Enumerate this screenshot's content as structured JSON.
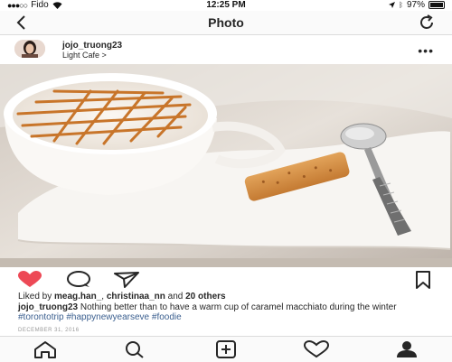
{
  "status_bar": {
    "carrier": "Fido",
    "time": "12:25 PM",
    "battery_percent": "97%",
    "battery_level": 0.97,
    "icons": [
      "signal-dots-icon",
      "wifi-icon",
      "location-arrow-icon",
      "bluetooth-icon",
      "battery-icon"
    ]
  },
  "nav": {
    "title": "Photo",
    "back_icon": "back-chevron-icon",
    "refresh_icon": "refresh-icon"
  },
  "post": {
    "username": "jojo_truong23",
    "location": "Light Cafe >",
    "more_icon": "more-options-icon",
    "photo_description_icon": "caramel-macchiato-photo"
  },
  "actions": {
    "icons": [
      "heart-icon",
      "comment-icon",
      "share-icon",
      "bookmark-icon"
    ],
    "like_color": "#ed4956"
  },
  "likes": {
    "prefix": "Liked by ",
    "user1": "meag.han_",
    "separator": ", ",
    "user2": "christinaa_nn",
    "middle": " and ",
    "others": "20 others"
  },
  "caption": {
    "user": "jojo_truong23",
    "text": " Nothing better than to have a warm cup of caramel macchiato during the winter ",
    "tag1": "#torontotrip",
    "tag2": "#happynewyearseve",
    "tag3": "#foodie"
  },
  "date": "DECEMBER 31, 2016",
  "tab_bar": {
    "icons": [
      "home-icon",
      "search-icon",
      "new-post-icon",
      "activity-heart-icon",
      "profile-icon"
    ]
  },
  "colors": {
    "hashtag": "#3b5f8f",
    "caramel": "#c8752a"
  }
}
